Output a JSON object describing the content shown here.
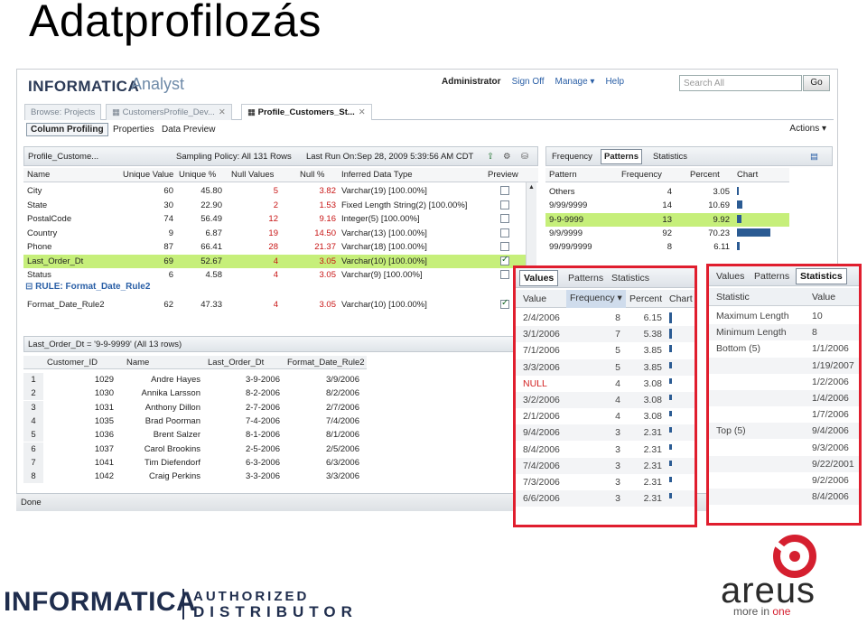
{
  "slide_title": "Adatprofilozás",
  "app": {
    "logo": "INFORMATICA",
    "product": "Analyst",
    "user": "Administrator",
    "links": [
      "Sign Off",
      "Manage ▾",
      "Help"
    ],
    "search_placeholder": "Search All",
    "go_label": "Go"
  },
  "tabs": [
    {
      "label": "Browse: Projects",
      "closable": false,
      "active": false
    },
    {
      "label": "CustomersProfile_Dev...",
      "closable": true,
      "active": false
    },
    {
      "label": "Profile_Customers_St...",
      "closable": true,
      "active": true
    }
  ],
  "subtoolbar": {
    "items": [
      "Column Profiling",
      "Properties",
      "Data Preview"
    ],
    "actions": "Actions ▾"
  },
  "profile_header": {
    "name": "Profile_Custome...",
    "sampling": "Sampling Policy: All 131 Rows",
    "last_run": "Last Run On:Sep 28, 2009 5:39:56 AM CDT"
  },
  "columns_grid": {
    "headers": [
      "Name",
      "Unique Value",
      "Unique %",
      "Null Values",
      "Null %",
      "Inferred Data Type",
      "Preview"
    ],
    "rows": [
      {
        "name": "City",
        "unique": "60",
        "unique_pct": "45.80",
        "nulls": "5",
        "null_pct": "3.82",
        "type": "Varchar(19) [100.00%]",
        "preview": false,
        "hl": false
      },
      {
        "name": "State",
        "unique": "30",
        "unique_pct": "22.90",
        "nulls": "2",
        "null_pct": "1.53",
        "type": "Fixed Length String(2) [100.00%]",
        "preview": false,
        "hl": false
      },
      {
        "name": "PostalCode",
        "unique": "74",
        "unique_pct": "56.49",
        "nulls": "12",
        "null_pct": "9.16",
        "type": "Integer(5) [100.00%]",
        "preview": false,
        "hl": false
      },
      {
        "name": "Country",
        "unique": "9",
        "unique_pct": "6.87",
        "nulls": "19",
        "null_pct": "14.50",
        "type": "Varchar(13) [100.00%]",
        "preview": false,
        "hl": false
      },
      {
        "name": "Phone",
        "unique": "87",
        "unique_pct": "66.41",
        "nulls": "28",
        "null_pct": "21.37",
        "type": "Varchar(18) [100.00%]",
        "preview": false,
        "hl": false
      },
      {
        "name": "Last_Order_Dt",
        "unique": "69",
        "unique_pct": "52.67",
        "nulls": "4",
        "null_pct": "3.05",
        "type": "Varchar(10) [100.00%]",
        "preview": true,
        "hl": true
      },
      {
        "name": "Status",
        "unique": "6",
        "unique_pct": "4.58",
        "nulls": "4",
        "null_pct": "3.05",
        "type": "Varchar(9) [100.00%]",
        "preview": false,
        "hl": false
      }
    ],
    "rule_label": "⊟ RULE: Format_Date_Rule2",
    "rule_row": {
      "name": "Format_Date_Rule2",
      "unique": "62",
      "unique_pct": "47.33",
      "nulls": "4",
      "null_pct": "3.05",
      "type": "Varchar(10) [100.00%]",
      "preview": true
    }
  },
  "preview_grid": {
    "title": "Last_Order_Dt = '9-9-9999' (All 13 rows)",
    "headers": [
      "Customer_ID",
      "Name",
      "Last_Order_Dt",
      "Format_Date_Rule2"
    ],
    "rows": [
      [
        "1",
        "1029",
        "Andre Hayes",
        "3-9-2006",
        "3/9/2006"
      ],
      [
        "2",
        "1030",
        "Annika Larsson",
        "8-2-2006",
        "8/2/2006"
      ],
      [
        "3",
        "1031",
        "Anthony Dillon",
        "2-7-2006",
        "2/7/2006"
      ],
      [
        "4",
        "1035",
        "Brad Poorman",
        "7-4-2006",
        "7/4/2006"
      ],
      [
        "5",
        "1036",
        "Brent Salzer",
        "8-1-2006",
        "8/1/2006"
      ],
      [
        "6",
        "1037",
        "Carol Brookins",
        "2-5-2006",
        "2/5/2006"
      ],
      [
        "7",
        "1041",
        "Tim Diefendorf",
        "6-3-2006",
        "6/3/2006"
      ],
      [
        "8",
        "1042",
        "Craig Perkins",
        "3-3-2006",
        "3/3/2006"
      ]
    ]
  },
  "status": "Done",
  "patterns_panel": {
    "tabs": [
      "Frequency",
      "Patterns",
      "Statistics"
    ],
    "active_tab": "Patterns",
    "headers": [
      "Pattern",
      "Frequency",
      "Percent",
      "Chart"
    ],
    "rows": [
      {
        "pattern": "Others",
        "freq": "4",
        "pct": "3.05",
        "value": 3.05,
        "hl": false
      },
      {
        "pattern": "9/99/9999",
        "freq": "14",
        "pct": "10.69",
        "value": 10.69,
        "hl": false
      },
      {
        "pattern": "9-9-9999",
        "freq": "13",
        "pct": "9.92",
        "value": 9.92,
        "hl": true
      },
      {
        "pattern": "9/9/9999",
        "freq": "92",
        "pct": "70.23",
        "value": 70.23,
        "hl": false
      },
      {
        "pattern": "99/99/9999",
        "freq": "8",
        "pct": "6.11",
        "value": 6.11,
        "hl": false
      }
    ]
  },
  "values_zoom": {
    "tabs": [
      "Values",
      "Patterns",
      "Statistics"
    ],
    "active_tab": "Values",
    "headers": [
      "Value",
      "Frequency ▾",
      "Percent",
      "Chart"
    ],
    "rows": [
      {
        "value": "2/4/2006",
        "freq": "8",
        "pct": "6.15",
        "null": false
      },
      {
        "value": "3/1/2006",
        "freq": "7",
        "pct": "5.38",
        "null": false
      },
      {
        "value": "7/1/2006",
        "freq": "5",
        "pct": "3.85",
        "null": false
      },
      {
        "value": "3/3/2006",
        "freq": "5",
        "pct": "3.85",
        "null": false
      },
      {
        "value": "NULL",
        "freq": "4",
        "pct": "3.08",
        "null": true
      },
      {
        "value": "3/2/2006",
        "freq": "4",
        "pct": "3.08",
        "null": false
      },
      {
        "value": "2/1/2006",
        "freq": "4",
        "pct": "3.08",
        "null": false
      },
      {
        "value": "9/4/2006",
        "freq": "3",
        "pct": "2.31",
        "null": false
      },
      {
        "value": "8/4/2006",
        "freq": "3",
        "pct": "2.31",
        "null": false
      },
      {
        "value": "7/4/2006",
        "freq": "3",
        "pct": "2.31",
        "null": false
      },
      {
        "value": "7/3/2006",
        "freq": "3",
        "pct": "2.31",
        "null": false
      },
      {
        "value": "6/6/2006",
        "freq": "3",
        "pct": "2.31",
        "null": false
      }
    ]
  },
  "stats_zoom": {
    "tabs": [
      "Values",
      "Patterns",
      "Statistics"
    ],
    "active_tab": "Statistics",
    "headers": [
      "Statistic",
      "Value"
    ],
    "rows": [
      {
        "stat": "Maximum Length",
        "value": "10"
      },
      {
        "stat": "Minimum Length",
        "value": "8"
      },
      {
        "stat": "Bottom (5)",
        "value": "1/1/2006"
      },
      {
        "stat": "",
        "value": "1/19/2007"
      },
      {
        "stat": "",
        "value": "1/2/2006"
      },
      {
        "stat": "",
        "value": "1/4/2006"
      },
      {
        "stat": "",
        "value": "1/7/2006"
      },
      {
        "stat": "Top (5)",
        "value": "9/4/2006"
      },
      {
        "stat": "",
        "value": "9/3/2006"
      },
      {
        "stat": "",
        "value": "9/22/2001"
      },
      {
        "stat": "",
        "value": "9/2/2006"
      },
      {
        "stat": "",
        "value": "8/4/2006"
      }
    ]
  },
  "footer": {
    "informatica": "INFORMATICA",
    "authorized": "AUTHORIZED",
    "distributor": "DISTRIBUTOR",
    "areus": "areus",
    "tag_more": "more in",
    "tag_one": "one",
    "brand_red": "#d51f2f"
  }
}
